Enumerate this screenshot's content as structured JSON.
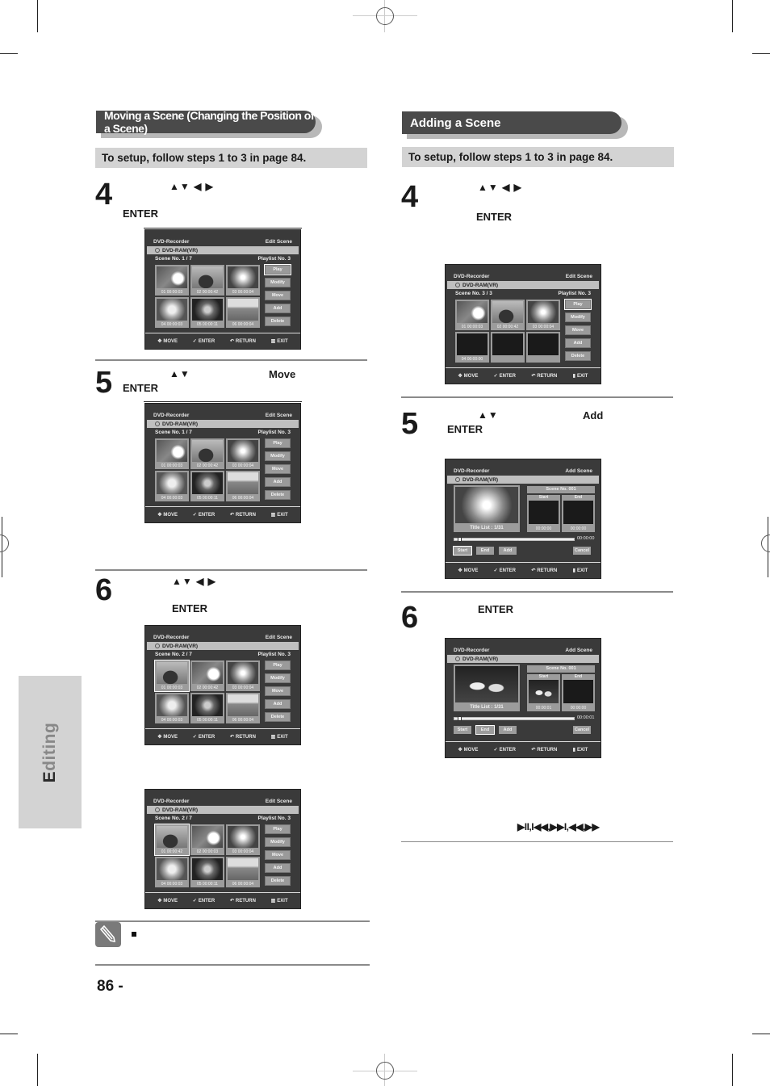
{
  "side_tab": {
    "first_letter": "E",
    "rest": "diting"
  },
  "left_section": {
    "title": "Moving a Scene (Changing the Position of a Scene)",
    "setup": "To setup, follow steps 1 to 3 in page 84.",
    "steps": [
      {
        "num": "4",
        "arrows": "▲▼ ◀ ▶",
        "enter": "ENTER"
      },
      {
        "num": "5",
        "arrows": "▲▼",
        "keyword": "Move",
        "enter": "ENTER"
      },
      {
        "num": "6",
        "arrows": "▲▼ ◀ ▶",
        "enter": "ENTER"
      }
    ]
  },
  "right_section": {
    "title": "Adding a Scene",
    "setup": "To setup, follow steps 1 to 3 in page 84.",
    "steps": [
      {
        "num": "4",
        "arrows": "▲▼ ◀ ▶",
        "enter": "ENTER"
      },
      {
        "num": "5",
        "arrows": "▲▼",
        "keyword": "Add",
        "enter": "ENTER"
      },
      {
        "num": "6",
        "enter": "ENTER"
      }
    ],
    "playback_keys": "▶II,I◀◀,▶▶I,◀◀,▶▶"
  },
  "osd_common": {
    "device": "DVD-Recorder",
    "disc": "DVD-RAM(VR)",
    "scene_no_label": "Scene No.",
    "playlist_label": "Playlist No.",
    "playlist_no": "3",
    "buttons": [
      "Play",
      "Modify",
      "Move",
      "Add",
      "Delete"
    ],
    "footer": [
      "MOVE",
      "ENTER",
      "RETURN",
      "EXIT"
    ]
  },
  "edit_screens": [
    {
      "mode": "Edit Scene",
      "scene": "1 / 7",
      "thumbs": [
        "01  00:00:03",
        "02  00:00:42",
        "03  00:00:04",
        "04  00:00:03",
        "05  00:00:11",
        "06  00:00:04"
      ]
    },
    {
      "mode": "Edit Scene",
      "scene": "1 / 7",
      "thumbs": [
        "01  00:00:03",
        "02  00:00:42",
        "03  00:00:04",
        "04  00:00:03",
        "05  00:00:11",
        "06  00:00:04"
      ]
    },
    {
      "mode": "Edit Scene",
      "scene": "2 / 7",
      "thumbs": [
        "01  00:00:03",
        "02  00:00:42",
        "03  00:00:04",
        "04  00:00:03",
        "05  00:00:11",
        "06  00:00:04"
      ]
    },
    {
      "mode": "Edit Scene",
      "scene": "2 / 7",
      "thumbs": [
        "01  00:00:42",
        "02  00:00:03",
        "03  00:00:04",
        "04  00:00:03",
        "05  00:00:11",
        "06  00:00:04"
      ]
    },
    {
      "mode": "Edit Scene",
      "scene": "3 / 3",
      "thumbs": [
        "01  00:00:03",
        "02  00:00:42",
        "03  00:00:04",
        "04  00:00:00",
        "",
        ""
      ]
    }
  ],
  "add_screens": [
    {
      "mode": "Add Scene",
      "title_list": "Title List : 1/31",
      "scene_no": "Scene No. 001",
      "start_label": "Start",
      "end_label": "End",
      "start_time": "00:00:00",
      "end_time": "00:00:00",
      "progress_time": "00:00:00",
      "buttons": [
        "Start",
        "End",
        "Add",
        "Cancel"
      ]
    },
    {
      "mode": "Add Scene",
      "title_list": "Title List : 1/31",
      "scene_no": "Scene No. 001",
      "start_label": "Start",
      "end_label": "End",
      "start_time": "00:00:01",
      "end_time": "00:00:00",
      "progress_time": "00:00:01",
      "buttons": [
        "Start",
        "End",
        "Add",
        "Cancel"
      ]
    }
  ],
  "page_number": "86 -"
}
